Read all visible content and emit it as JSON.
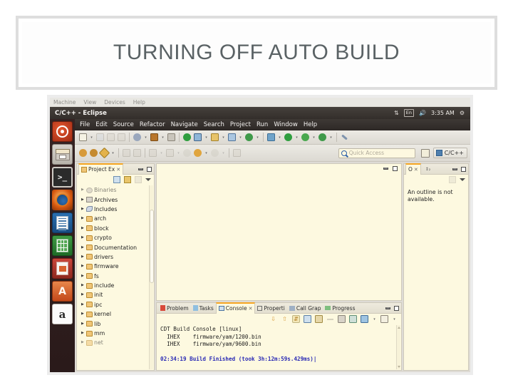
{
  "slide": {
    "title": "TURNING OFF AUTO BUILD",
    "title_color": "#5a6265"
  },
  "vbox_menu": {
    "items": [
      "Machine",
      "View",
      "Devices",
      "Help"
    ]
  },
  "ubuntu_panel": {
    "window_title": "C/C++ - Eclipse",
    "network_icon": "network-updown-icon",
    "keyboard_layout": "En",
    "volume_icon": "volume-icon",
    "clock": "3:35 AM",
    "session_icon": "power-gear-icon"
  },
  "launcher": {
    "items": [
      {
        "name": "ubuntu-dash",
        "label": "Ubuntu Dash"
      },
      {
        "name": "files",
        "label": "Files"
      },
      {
        "name": "terminal",
        "label": "Terminal",
        "glyph": ">_"
      },
      {
        "name": "firefox",
        "label": "Firefox"
      },
      {
        "name": "libreoffice-writer",
        "label": "LibreOffice Writer"
      },
      {
        "name": "libreoffice-calc",
        "label": "LibreOffice Calc"
      },
      {
        "name": "libreoffice-impress",
        "label": "LibreOffice Impress"
      },
      {
        "name": "software-center",
        "label": "Ubuntu Software Center",
        "glyph": "A"
      },
      {
        "name": "amazon",
        "label": "Amazon",
        "glyph": "a"
      }
    ]
  },
  "eclipse_menu": {
    "items": [
      "File",
      "Edit",
      "Source",
      "Refactor",
      "Navigate",
      "Search",
      "Project",
      "Run",
      "Window",
      "Help"
    ]
  },
  "toolbar": {
    "quick_access_placeholder": "Quick Access",
    "quick_access_value": "",
    "perspective_label": "C/C++",
    "open_perspective_icon": "open-perspective-icon",
    "search_icon": "search-icon"
  },
  "project_explorer": {
    "tab_label": "Project Ex",
    "close_icon": "close-icon",
    "minimize_icon": "minimize-icon",
    "maximize_icon": "maximize-icon",
    "toolbar_icons": [
      "collapse-all-icon",
      "link-with-editor-icon",
      "focus-icon",
      "view-menu-icon"
    ],
    "tree": [
      {
        "label": "Binaries",
        "icon": "binaries-icon",
        "clipped": true
      },
      {
        "label": "Archives",
        "icon": "archives-icon",
        "clipped": false
      },
      {
        "label": "Includes",
        "icon": "includes-icon",
        "clipped": false
      },
      {
        "label": "arch",
        "icon": "folder-icon",
        "clipped": false
      },
      {
        "label": "block",
        "icon": "folder-icon",
        "clipped": false
      },
      {
        "label": "crypto",
        "icon": "folder-icon",
        "clipped": false
      },
      {
        "label": "Documentation",
        "icon": "folder-icon",
        "clipped": false
      },
      {
        "label": "drivers",
        "icon": "folder-icon",
        "clipped": false
      },
      {
        "label": "firmware",
        "icon": "folder-icon",
        "clipped": false
      },
      {
        "label": "fs",
        "icon": "folder-icon",
        "clipped": false
      },
      {
        "label": "include",
        "icon": "folder-icon",
        "clipped": false
      },
      {
        "label": "init",
        "icon": "folder-icon",
        "clipped": false
      },
      {
        "label": "ipc",
        "icon": "folder-icon",
        "clipped": false
      },
      {
        "label": "kernel",
        "icon": "folder-icon",
        "clipped": false
      },
      {
        "label": "lib",
        "icon": "folder-icon",
        "clipped": false
      },
      {
        "label": "mm",
        "icon": "folder-icon",
        "clipped": false
      },
      {
        "label": "net",
        "icon": "folder-icon",
        "clipped": true
      }
    ]
  },
  "editor": {
    "content": "",
    "minimize_icon": "minimize-icon",
    "maximize_icon": "maximize-icon"
  },
  "outline": {
    "tab_label": "O",
    "close_icon": "close-icon",
    "sort_icon": "sort-icon",
    "message": "An outline is not available."
  },
  "bottom_panel": {
    "tabs": [
      {
        "label": "Problem",
        "icon": "problems-icon",
        "active": false
      },
      {
        "label": "Tasks",
        "icon": "tasks-icon",
        "active": false
      },
      {
        "label": "Console",
        "icon": "console-icon",
        "active": true
      },
      {
        "label": "Properti",
        "icon": "properties-icon",
        "active": false
      },
      {
        "label": "Call Grap",
        "icon": "call-graph-icon",
        "active": false
      },
      {
        "label": "Progress",
        "icon": "progress-icon",
        "active": false
      }
    ],
    "toolbar_icons": [
      "scroll-down-icon",
      "scroll-up-icon",
      "scroll-lock-icon",
      "clear-console-icon",
      "lock-console-icon",
      "word-wrap-icon",
      "remove-console-icon",
      "pin-console-icon",
      "display-console-icon",
      "display-console-dropdown-icon",
      "new-console-icon",
      "new-console-dropdown-icon"
    ],
    "console": {
      "header": "CDT Build Console [linux]",
      "lines": [
        "  IHEX    firmware/yam/1200.bin",
        "  IHEX    firmware/yam/9600.bin",
        "",
        "02:34:19 Build Finished (took 3h:12m:59s.429ms)"
      ],
      "build_line_color": "#2a2ab5"
    }
  }
}
